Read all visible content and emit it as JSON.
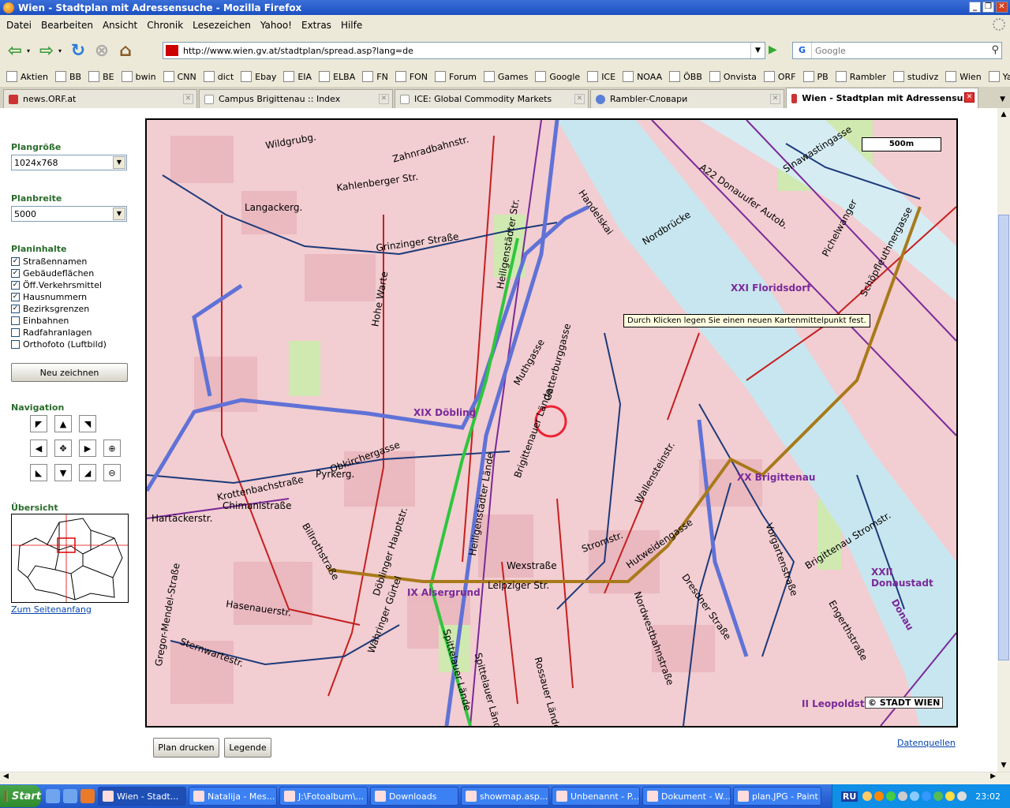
{
  "window": {
    "title": "Wien - Stadtplan mit Adressensuche - Mozilla Firefox"
  },
  "menu": [
    "Datei",
    "Bearbeiten",
    "Ansicht",
    "Chronik",
    "Lesezeichen",
    "Yahoo!",
    "Extras",
    "Hilfe"
  ],
  "address": {
    "url": "http://www.wien.gv.at/stadtplan/spread.asp?lang=de"
  },
  "search": {
    "placeholder": "Google"
  },
  "bookmarks": [
    "Aktien",
    "BB",
    "BE",
    "bwin",
    "CNN",
    "dict",
    "Ebay",
    "EIA",
    "ELBA",
    "FN",
    "FON",
    "Forum",
    "Games",
    "Google",
    "ICE",
    "NOAA",
    "ÖBB",
    "Onvista",
    "ORF",
    "PB",
    "Rambler",
    "studivz",
    "Wien",
    "Yahoo"
  ],
  "tabs": [
    {
      "label": "news.ORF.at"
    },
    {
      "label": "Campus Brigittenau :: Index"
    },
    {
      "label": "ICE: Global Commodity Markets"
    },
    {
      "label": "Rambler-Словари"
    },
    {
      "label": "Wien - Stadtplan mit Adressensu..."
    }
  ],
  "panel": {
    "plangroesse_label": "Plangröße",
    "plangroesse_value": "1024x768",
    "planbreite_label": "Planbreite",
    "planbreite_value": "5000",
    "planinhalte_label": "Planinhalte",
    "options": [
      {
        "label": "Straßennamen",
        "checked": true
      },
      {
        "label": "Gebäudeflächen",
        "checked": true
      },
      {
        "label": "Öff.Verkehrsmittel",
        "checked": true
      },
      {
        "label": "Hausnummern",
        "checked": true
      },
      {
        "label": "Bezirksgrenzen",
        "checked": true
      },
      {
        "label": "Einbahnen",
        "checked": false
      },
      {
        "label": "Radfahranlagen",
        "checked": false
      },
      {
        "label": "Orthofoto (Luftbild)",
        "checked": false
      }
    ],
    "redraw_label": "Neu zeichnen",
    "navigation_label": "Navigation",
    "overview_label": "Übersicht",
    "top_link": "Zum Seitenanfang"
  },
  "map": {
    "scale": "500m",
    "tooltip": "Durch Klicken legen Sie einen neuen Kartenmittelpunkt fest.",
    "copyright": "© STADT WIEN",
    "districts": [
      "XIX Döbling",
      "XXI Floridsdorf",
      "XX Brigittenau",
      "XXII Donaustadt",
      "IX Alsergrund",
      "II Leopoldst",
      "Donau"
    ],
    "streets": [
      "Krottenbachstraße",
      "Grinzinger Straße",
      "Handelskai",
      "Nordbrücke",
      "Heiligenstädter Lände",
      "Brigittenauer Lände",
      "Spittelauer Lände",
      "Leipziger Str.",
      "Wexstraße",
      "Stromstr.",
      "Nordwestbahnstraße",
      "Wallensteinstr.",
      "Dresdner Straße",
      "Vorgartenstraße",
      "Engerthstraße",
      "Brigittenau Stromstr.",
      "Sinawastingasse",
      "Pichelwanger",
      "Schöpfleuthnergasse",
      "Döblinger Hauptstr.",
      "Gatterburggasse",
      "Billrothstraße",
      "Hasenauerstr.",
      "Sternwartestr.",
      "Pyrkerg.",
      "Hohe Warte",
      "Muthgasse",
      "A22 Donauufer Autob.",
      "Gregor-Mendel-Straße",
      "Hartäckerstr.",
      "Langackerg.",
      "Wildgrubg.",
      "Zahnradbahnstr.",
      "Kahlenberger Str.",
      "Heiligenstädter Str.",
      "Chimanistraße",
      "Obkirchergasse",
      "Hutweidengasse",
      "Währinger Gürtel",
      "Spittelauer Lände",
      "Rossauer Lände"
    ]
  },
  "buttons": {
    "print": "Plan drucken",
    "legend": "Legende",
    "datenquellen": "Datenquellen"
  },
  "taskbar": {
    "start": "Start",
    "tasks": [
      "Wien - Stadt...",
      "Natalija - Mes...",
      "J:\\Fotoalbum\\...",
      "Downloads",
      "showmap.asp...",
      "Unbenannt - P...",
      "Dokument - W...",
      "plan.JPG - Paint"
    ],
    "clock": "23:02",
    "lang": "RU"
  }
}
